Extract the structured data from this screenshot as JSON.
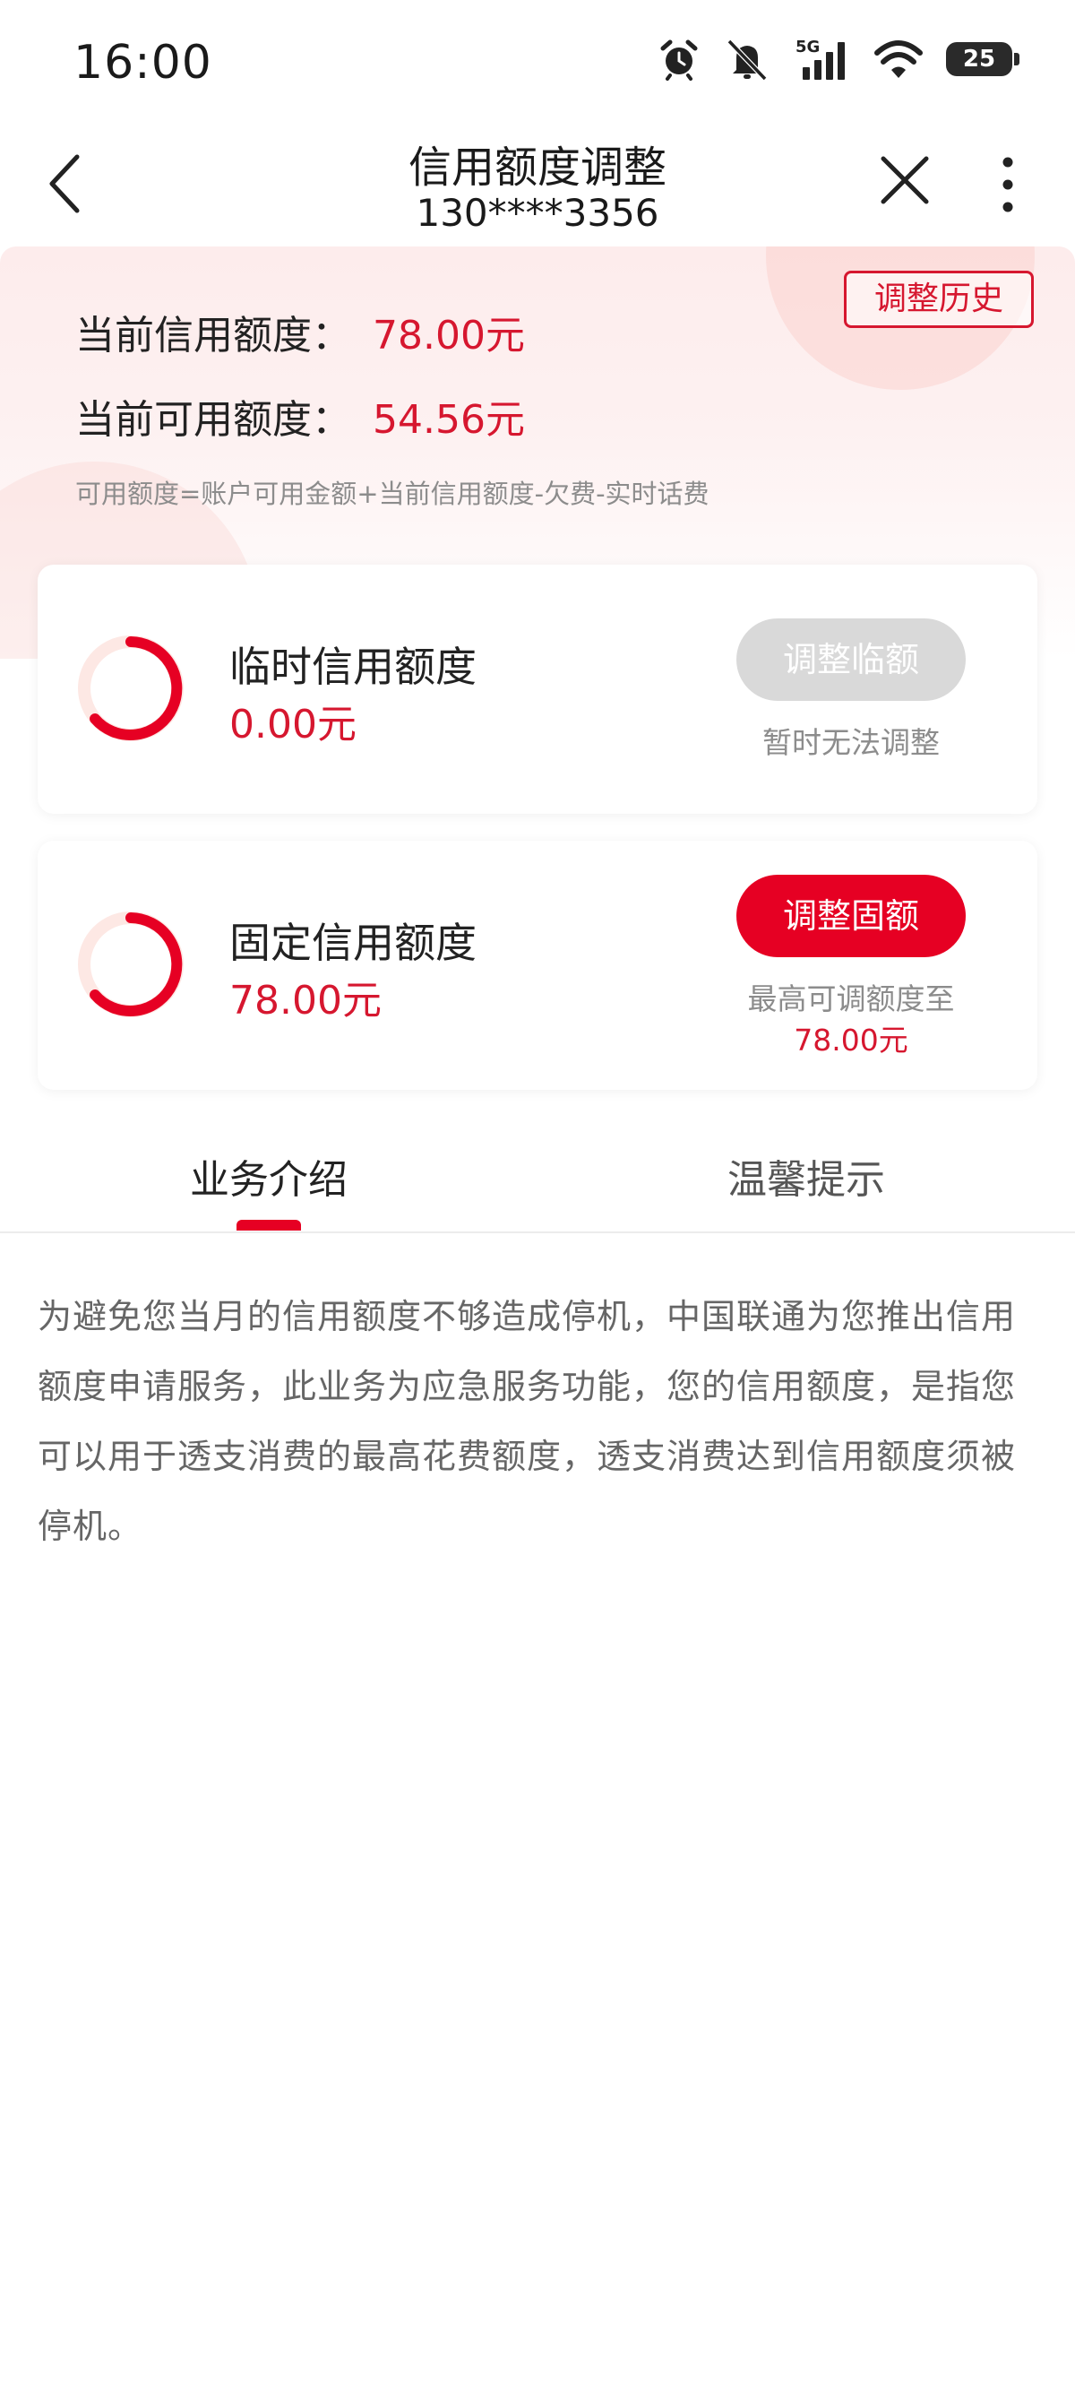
{
  "status": {
    "time": "16:00",
    "network": "5G",
    "battery": "25"
  },
  "nav": {
    "title": "信用额度调整",
    "subtitle": "130****3356"
  },
  "header": {
    "history_button": "调整历史",
    "current_credit_label": "当前信用额度：",
    "current_credit_value": "78.00元",
    "available_label": "当前可用额度：",
    "available_value": "54.56元",
    "formula": "可用额度=账户可用金额+当前信用额度-欠费-实时话费"
  },
  "cards": [
    {
      "title": "临时信用额度",
      "value": "0.00元",
      "button": "调整临额",
      "button_state": "disabled",
      "note": "暂时无法调整"
    },
    {
      "title": "固定信用额度",
      "value": "78.00元",
      "button": "调整固额",
      "button_state": "active",
      "note": "最高可调额度至",
      "note_value": "78.00元"
    }
  ],
  "tabs": [
    {
      "label": "业务介绍",
      "active": true
    },
    {
      "label": "温馨提示",
      "active": false
    }
  ],
  "content": "为避免您当月的信用额度不够造成停机，中国联通为您推出信用额度申请服务，此业务为应急服务功能，您的信用额度，是指您可以用于透支消费的最高花费额度，透支消费达到信用额度须被停机。",
  "colors": {
    "accent": "#e60023",
    "accent_text": "#d6172f",
    "disabled": "#d9d9d9"
  }
}
